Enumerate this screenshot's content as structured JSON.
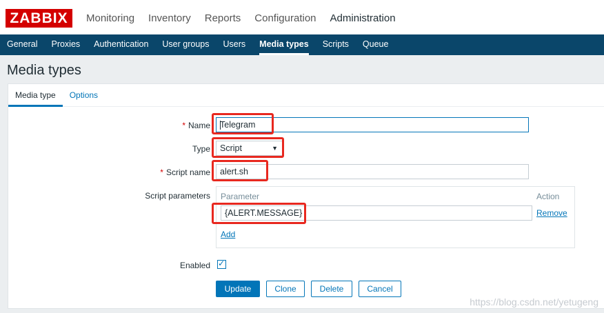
{
  "brand": {
    "logo": "ZABBIX"
  },
  "main_nav": [
    {
      "label": "Monitoring"
    },
    {
      "label": "Inventory"
    },
    {
      "label": "Reports"
    },
    {
      "label": "Configuration"
    },
    {
      "label": "Administration"
    }
  ],
  "sub_nav": [
    {
      "label": "General"
    },
    {
      "label": "Proxies"
    },
    {
      "label": "Authentication"
    },
    {
      "label": "User groups"
    },
    {
      "label": "Users"
    },
    {
      "label": "Media types"
    },
    {
      "label": "Scripts"
    },
    {
      "label": "Queue"
    }
  ],
  "page": {
    "title": "Media types"
  },
  "tabs": [
    {
      "label": "Media type"
    },
    {
      "label": "Options"
    }
  ],
  "form": {
    "name_label": "Name",
    "name_value": "Telegram",
    "type_label": "Type",
    "type_value": "Script",
    "script_name_label": "Script name",
    "script_name_value": "alert.sh",
    "script_params_label": "Script parameters",
    "param_col_header": "Parameter",
    "action_col_header": "Action",
    "param_value": "{ALERT.MESSAGE}",
    "remove_label": "Remove",
    "add_label": "Add",
    "enabled_label": "Enabled",
    "enabled_checked": true,
    "required_mark": "*",
    "checkmark": "✓",
    "dropdown_arrow": "▼"
  },
  "buttons": {
    "update": "Update",
    "clone": "Clone",
    "delete": "Delete",
    "cancel": "Cancel"
  },
  "watermark": "https://blog.csdn.net/yetugeng",
  "colors": {
    "logo_red": "#d40000",
    "subnav_bg": "#0a466a",
    "accent_blue": "#0275b8",
    "highlight_red": "#e8281f"
  }
}
